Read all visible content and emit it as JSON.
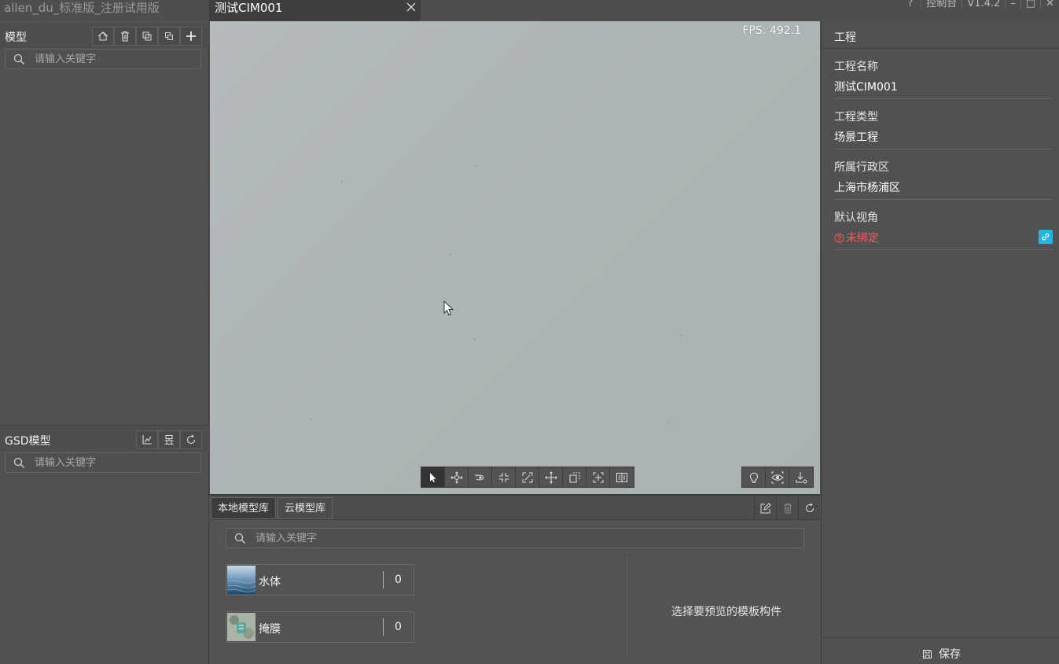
{
  "app": {
    "title": "allen_du_标准版_注册试用版",
    "version": "V1.4.2",
    "console_label": "控制台",
    "help_label": "?"
  },
  "document_tab": {
    "label": "测试CIM001"
  },
  "model_panel": {
    "title": "模型",
    "search_placeholder": "请输入关键字"
  },
  "gsd_panel": {
    "title": "GSD模型",
    "search_placeholder": "请输入关键字"
  },
  "viewport": {
    "fps_text": "FPS: 492.1"
  },
  "library": {
    "tabs": [
      "本地模型库",
      "云模型库"
    ],
    "active_tab": "本地模型库",
    "search_placeholder": "请输入关键字",
    "items": [
      {
        "name": "水体",
        "count": "0"
      },
      {
        "name": "掩膜",
        "count": "0"
      }
    ],
    "preview_hint": "选择要预览的模板构件"
  },
  "project_panel": {
    "title": "工程",
    "properties": [
      {
        "label": "工程名称",
        "value": "测试CIM001"
      },
      {
        "label": "工程类型",
        "value": "场景工程"
      },
      {
        "label": "所属行政区",
        "value": "上海市杨浦区"
      },
      {
        "label": "默认视角",
        "value": "未绑定"
      }
    ],
    "save_label": "保存",
    "colors": {
      "warn": "#ff5757",
      "link_button": "#1fb6e8"
    }
  }
}
